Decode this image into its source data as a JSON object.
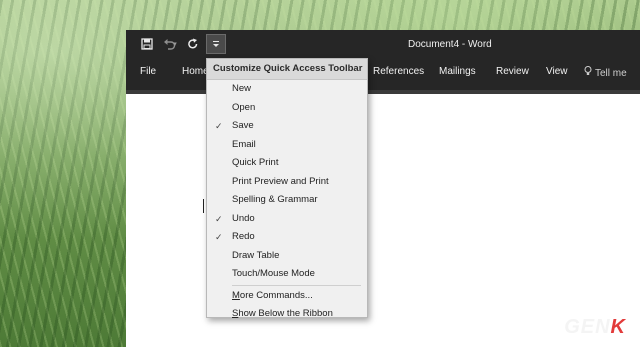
{
  "window": {
    "title": "Document4 - Word"
  },
  "qat": {
    "save_icon": "save-icon",
    "undo_icon": "undo-icon",
    "redo_icon": "repeat-icon",
    "customize_icon": "customize-caret-icon"
  },
  "ribbon": {
    "tabs": [
      "File",
      "Home",
      "References",
      "Mailings",
      "Review",
      "View"
    ],
    "tell_me": "Tell me"
  },
  "menu": {
    "header": "Customize Quick Access Toolbar",
    "items": [
      {
        "label": "New",
        "checked": false
      },
      {
        "label": "Open",
        "checked": false
      },
      {
        "label": "Save",
        "checked": true
      },
      {
        "label": "Email",
        "checked": false
      },
      {
        "label": "Quick Print",
        "checked": false
      },
      {
        "label": "Print Preview and Print",
        "checked": false
      },
      {
        "label": "Spelling & Grammar",
        "checked": false
      },
      {
        "label": "Undo",
        "checked": true
      },
      {
        "label": "Redo",
        "checked": true
      },
      {
        "label": "Draw Table",
        "checked": false
      },
      {
        "label": "Touch/Mouse Mode",
        "checked": false
      }
    ],
    "footer_items": [
      "More Commands...",
      "Show Below the Ribbon"
    ],
    "check_glyph": "✓"
  },
  "watermark": {
    "text_main": "GEN",
    "text_accent": "K"
  }
}
